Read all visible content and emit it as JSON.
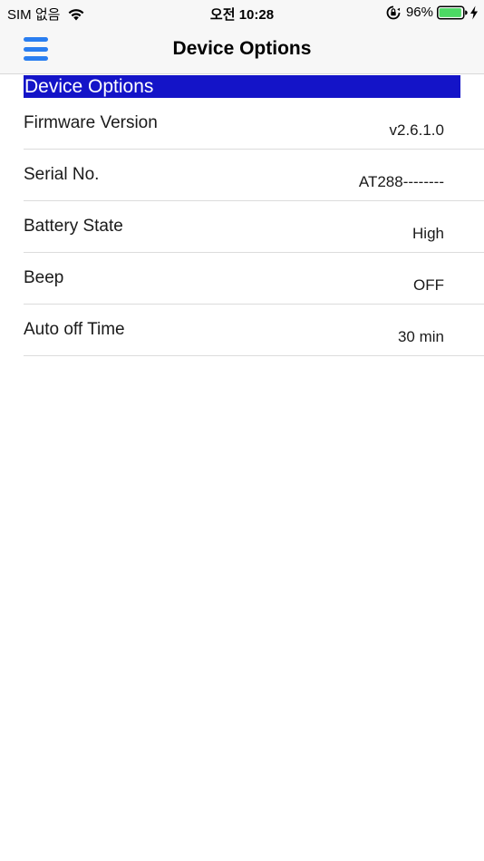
{
  "status_bar": {
    "carrier": "SIM 없음",
    "time": "오전 10:28",
    "battery_percent": "96%",
    "icons": [
      "wifi-icon",
      "rotation-lock-icon",
      "battery-icon",
      "charging-icon"
    ],
    "battery_level": 0.96,
    "battery_color": "#4cd964"
  },
  "nav": {
    "title": "Device Options",
    "menu_icon": "hamburger-menu-icon",
    "accent_color": "#2a7ef0"
  },
  "section": {
    "header": "Device Options",
    "header_bg": "#1414c8"
  },
  "options": [
    {
      "label": "Firmware Version",
      "value": "v2.6.1.0"
    },
    {
      "label": "Serial No.",
      "value": "AT288--------"
    },
    {
      "label": "Battery State",
      "value": "High"
    },
    {
      "label": "Beep",
      "value": "OFF"
    },
    {
      "label": "Auto off Time",
      "value": "30 min"
    }
  ]
}
